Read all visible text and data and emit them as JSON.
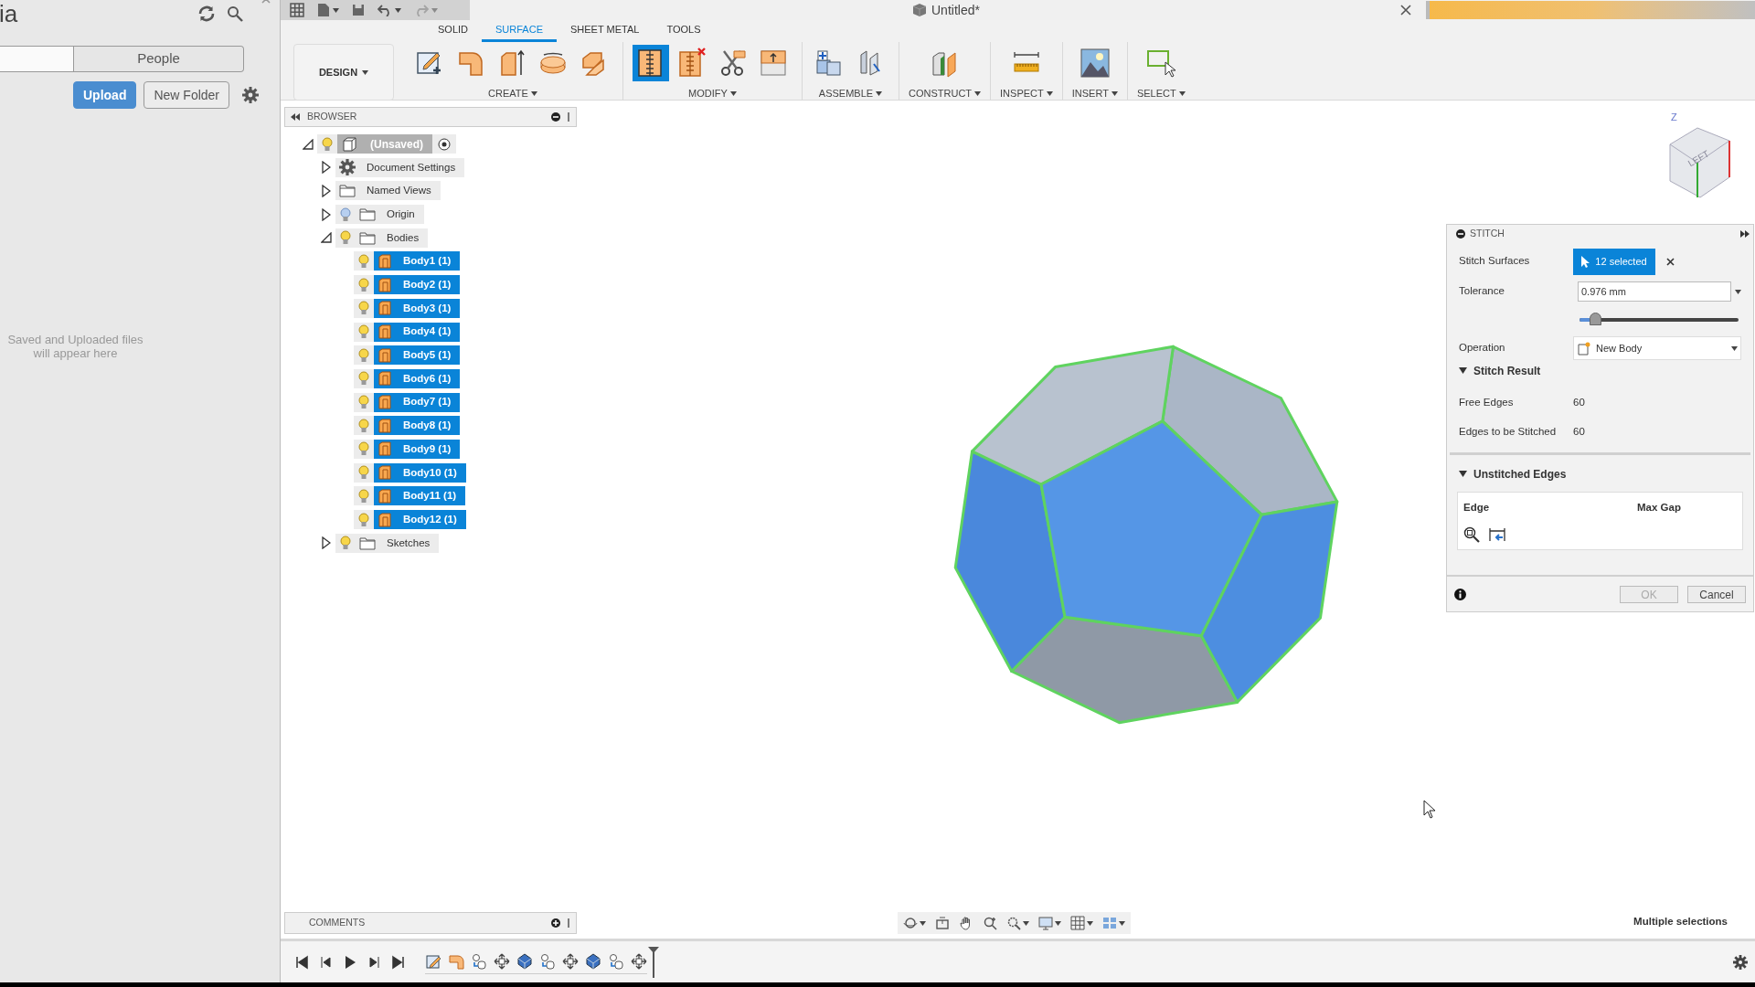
{
  "files_panel": {
    "title": "ia",
    "tabs": [
      {
        "selected": true
      },
      {
        "label": "People",
        "selected": false
      }
    ],
    "buttons": [
      {
        "label": "Upload",
        "kind": "primary"
      },
      {
        "label": "New Folder",
        "kind": "secondary"
      }
    ],
    "empty_message": "Saved and Uploaded files will appear here"
  },
  "document": {
    "title": "Untitled*"
  },
  "toolbar": {
    "workspace": "DESIGN",
    "tabs": [
      {
        "label": "SOLID",
        "selected": false
      },
      {
        "label": "SURFACE",
        "selected": true
      },
      {
        "label": "SHEET METAL",
        "selected": false
      },
      {
        "label": "TOOLS",
        "selected": false
      }
    ],
    "groups": [
      {
        "label": "CREATE",
        "tools": [
          {
            "selected": false
          },
          {
            "selected": false
          },
          {
            "selected": false
          },
          {
            "selected": false
          },
          {
            "selected": false
          }
        ]
      },
      {
        "label": "MODIFY",
        "tools": [
          {
            "selected": true
          },
          {
            "selected": false
          },
          {
            "selected": false
          },
          {
            "selected": false
          }
        ]
      },
      {
        "label": "ASSEMBLE",
        "tools": [
          {
            "selected": false
          },
          {
            "selected": false
          }
        ]
      },
      {
        "label": "CONSTRUCT",
        "tools": [
          {
            "selected": false
          }
        ]
      },
      {
        "label": "INSPECT",
        "tools": [
          {
            "selected": false
          }
        ]
      },
      {
        "label": "INSERT",
        "tools": [
          {
            "selected": false
          }
        ]
      },
      {
        "label": "SELECT",
        "tools": [
          {
            "selected": false
          }
        ]
      }
    ]
  },
  "browser": {
    "title": "BROWSER",
    "tree": [
      {
        "label": "(Unsaved)",
        "kind": "document",
        "visible": true,
        "expanded": true,
        "children": [
          {
            "label": "Document Settings",
            "kind": "settings",
            "expanded": false
          },
          {
            "label": "Named Views",
            "kind": "folder",
            "expanded": false
          },
          {
            "label": "Origin",
            "kind": "folder",
            "visible": false,
            "expanded": false
          },
          {
            "label": "Bodies",
            "kind": "folder",
            "visible": true,
            "expanded": true,
            "children": [
              {
                "label": "Body1 (1)",
                "kind": "body",
                "visible": true,
                "selected": true
              },
              {
                "label": "Body2 (1)",
                "kind": "body",
                "visible": true,
                "selected": true
              },
              {
                "label": "Body3 (1)",
                "kind": "body",
                "visible": true,
                "selected": true
              },
              {
                "label": "Body4 (1)",
                "kind": "body",
                "visible": true,
                "selected": true
              },
              {
                "label": "Body5 (1)",
                "kind": "body",
                "visible": true,
                "selected": true
              },
              {
                "label": "Body6 (1)",
                "kind": "body",
                "visible": true,
                "selected": true
              },
              {
                "label": "Body7 (1)",
                "kind": "body",
                "visible": true,
                "selected": true
              },
              {
                "label": "Body8 (1)",
                "kind": "body",
                "visible": true,
                "selected": true
              },
              {
                "label": "Body9 (1)",
                "kind": "body",
                "visible": true,
                "selected": true
              },
              {
                "label": "Body10 (1)",
                "kind": "body",
                "visible": true,
                "selected": true
              },
              {
                "label": "Body11 (1)",
                "kind": "body",
                "visible": true,
                "selected": true
              },
              {
                "label": "Body12 (1)",
                "kind": "body",
                "visible": true,
                "selected": true
              }
            ]
          },
          {
            "label": "Sketches",
            "kind": "folder",
            "visible": true,
            "expanded": false
          }
        ]
      }
    ]
  },
  "view_cube": {
    "face": "LEFT",
    "axis": "Z"
  },
  "stitch_dialog": {
    "title": "STITCH",
    "selection": {
      "label": "Stitch Surfaces",
      "value": "12 selected"
    },
    "tolerance": {
      "label": "Tolerance",
      "value": "0.976 mm",
      "level": 0.1
    },
    "operation": {
      "label": "Operation",
      "value": "New Body"
    },
    "sections": [
      {
        "title": "Stitch Result",
        "expanded": true,
        "rows": [
          {
            "label": "Free Edges",
            "value": "60"
          },
          {
            "label": "Edges to be Stitched",
            "value": "60"
          }
        ]
      },
      {
        "title": "Unstitched Edges",
        "expanded": true,
        "columns": [
          "Edge",
          "Max Gap"
        ]
      }
    ],
    "buttons": [
      {
        "label": "OK",
        "disabled": true
      },
      {
        "label": "Cancel",
        "disabled": false
      }
    ]
  },
  "comments": {
    "title": "COMMENTS"
  },
  "status": "Multiple selections",
  "timeline": {
    "features": [
      {
        "kind": "sketch"
      },
      {
        "kind": "surface"
      },
      {
        "kind": "align"
      },
      {
        "kind": "move"
      },
      {
        "kind": "pattern"
      },
      {
        "kind": "align"
      },
      {
        "kind": "move"
      },
      {
        "kind": "pattern"
      },
      {
        "kind": "align"
      },
      {
        "kind": "move"
      }
    ]
  }
}
